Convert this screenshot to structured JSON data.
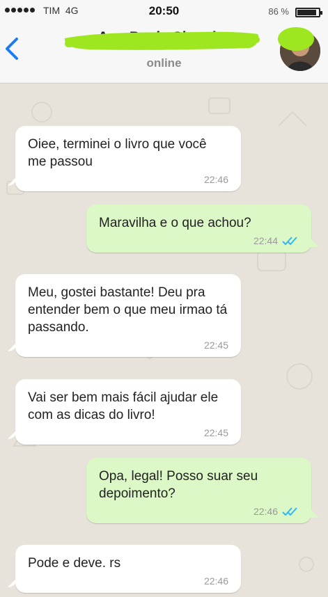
{
  "status_bar": {
    "carrier": "TIM",
    "network": "4G",
    "time": "20:50",
    "battery_percent": "86 %"
  },
  "header": {
    "contact_name": "Ana Paula Siqueira",
    "status": "online"
  },
  "colors": {
    "incoming_bubble": "#ffffff",
    "outgoing_bubble": "#dcf8c6",
    "tick_blue": "#34b7f1",
    "back_arrow": "#1a7cf2",
    "redaction_marker": "#9ee61f"
  },
  "messages": [
    {
      "direction": "in",
      "text": "Oiee, terminei o livro que você me passou",
      "time": "22:46"
    },
    {
      "direction": "out",
      "text": "Maravilha e o que achou?",
      "time": "22:44",
      "status": "read"
    },
    {
      "direction": "in",
      "text": "Meu, gostei bastante! Deu pra entender bem o que meu irmao tá passando.",
      "time": "22:45"
    },
    {
      "direction": "in",
      "text": "Vai ser bem mais fácil ajudar ele com as dicas do livro!",
      "time": "22:45"
    },
    {
      "direction": "out",
      "text": "Opa, legal! Posso suar seu depoimento?",
      "time": "22:46",
      "status": "read"
    },
    {
      "direction": "in",
      "text": "Pode e deve. rs",
      "time": "22:46"
    }
  ]
}
